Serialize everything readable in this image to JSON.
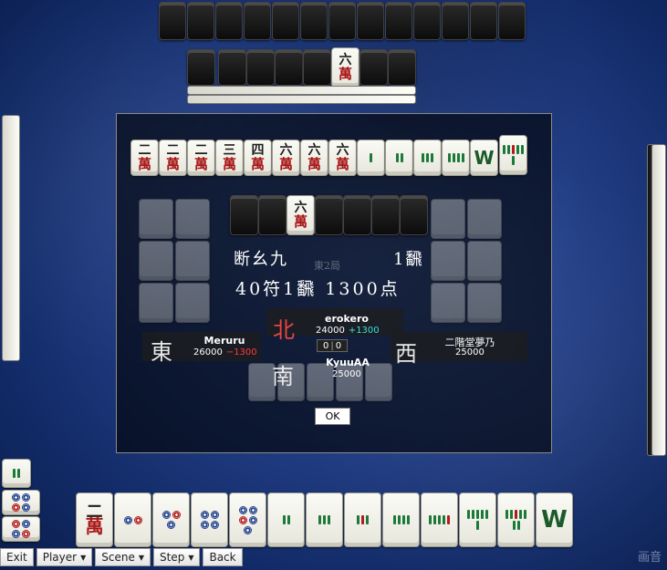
{
  "top_label": "",
  "dialog": {
    "yaku_name": "断幺九",
    "yaku_han": "1飜",
    "score_line": "40符1飜  1300点",
    "ok_label": "OK",
    "round_faint": "東2局"
  },
  "players": {
    "north": {
      "wind": "北",
      "name": "erokero",
      "score": "24000",
      "delta": "+1300"
    },
    "east": {
      "wind": "東",
      "name": "Meruru",
      "score": "26000",
      "delta": "−1300"
    },
    "west": {
      "wind": "西",
      "name": "二階堂夢乃",
      "score": "25000"
    },
    "south": {
      "wind": "南",
      "name": "KyuuAA",
      "score": "25000"
    }
  },
  "center": {
    "left": "0",
    "right": "0"
  },
  "toolbar": {
    "exit": "Exit",
    "player": "Player",
    "scene": "Scene",
    "step": "Step",
    "back": "Back"
  },
  "brand": "画音",
  "hand_tiles_winner": [
    "二萬",
    "二萬",
    "二萬",
    "三萬",
    "四萬",
    "六萬",
    "六萬",
    "六萬",
    "1索",
    "2索",
    "3索",
    "4索",
    "W",
    "8索"
  ],
  "bottom_hand": [
    "二萬",
    "2筒",
    "3筒",
    "4筒",
    "5筒",
    "2索",
    "3索",
    "3索",
    "4索",
    "5索",
    "6索",
    "7索",
    "W"
  ],
  "icons": {
    "dropdown": "caret-down-icon"
  }
}
